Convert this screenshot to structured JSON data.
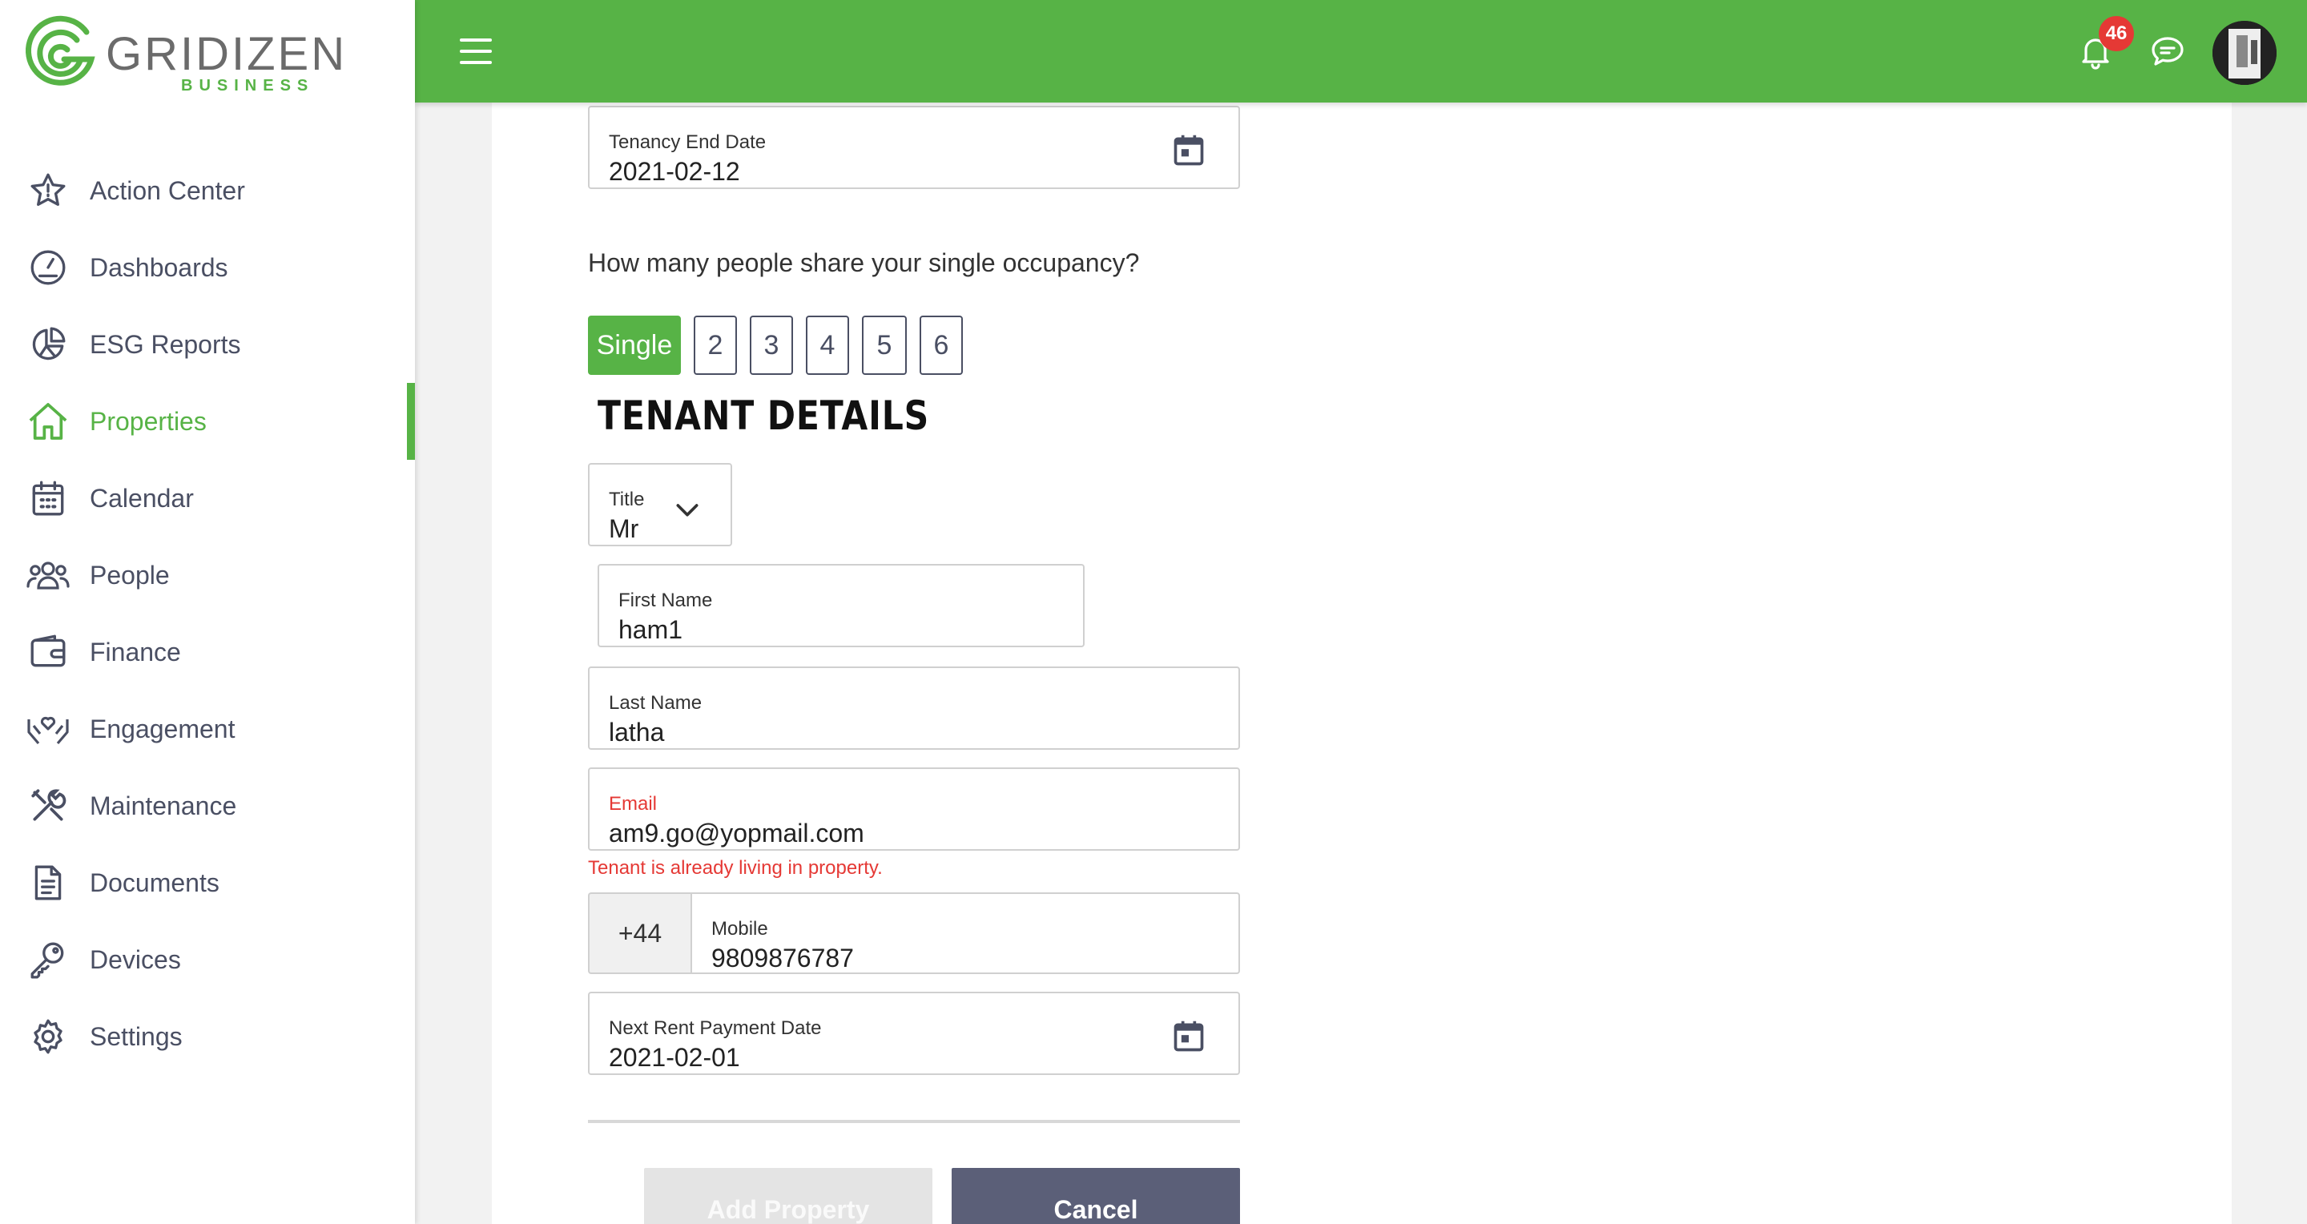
{
  "brand": {
    "name": "GRIDIZEN",
    "tagline": "BUSINESS",
    "accent": "#57b346",
    "sidebar_text": "#4a4f63"
  },
  "sidebar": {
    "items": [
      {
        "label": "Action Center",
        "icon": "star-icon",
        "active": false
      },
      {
        "label": "Dashboards",
        "icon": "gauge-icon",
        "active": false
      },
      {
        "label": "ESG Reports",
        "icon": "pie-chart-icon",
        "active": false
      },
      {
        "label": "Properties",
        "icon": "home-icon",
        "active": true
      },
      {
        "label": "Calendar",
        "icon": "calendar-icon",
        "active": false
      },
      {
        "label": "People",
        "icon": "people-icon",
        "active": false
      },
      {
        "label": "Finance",
        "icon": "wallet-icon",
        "active": false
      },
      {
        "label": "Engagement",
        "icon": "hands-heart-icon",
        "active": false
      },
      {
        "label": "Maintenance",
        "icon": "tools-icon",
        "active": false
      },
      {
        "label": "Documents",
        "icon": "document-icon",
        "active": false
      },
      {
        "label": "Devices",
        "icon": "key-icon",
        "active": false
      },
      {
        "label": "Settings",
        "icon": "gear-icon",
        "active": false
      }
    ]
  },
  "topbar": {
    "notification_count": "46",
    "error_color": "#e53935"
  },
  "form": {
    "tenancy_end": {
      "label": "Tenancy End Date",
      "value": "2021-02-12"
    },
    "occupancy_question": "How many people share your single occupancy?",
    "occupancy_options": [
      "Single",
      "2",
      "3",
      "4",
      "5",
      "6"
    ],
    "occupancy_selected": "Single",
    "section_title": "TENANT DETAILS",
    "title_field": {
      "label": "Title",
      "value": "Mr"
    },
    "first_name": {
      "label": "First Name",
      "value": "ham1"
    },
    "last_name": {
      "label": "Last Name",
      "value": "latha"
    },
    "email": {
      "label": "Email",
      "value": "am9.go@yopmail.com",
      "error": "Tenant is already living in property."
    },
    "mobile": {
      "prefix": "+44",
      "label": "Mobile",
      "value": "9809876787"
    },
    "next_rent": {
      "label": "Next Rent Payment Date",
      "value": "2021-02-01"
    },
    "add_button": "Add Property",
    "cancel_button": "Cancel"
  }
}
